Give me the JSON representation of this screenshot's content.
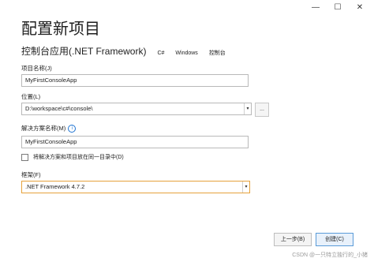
{
  "window": {
    "controls": {
      "minimize": "—",
      "maximize": "☐",
      "close": "✕"
    }
  },
  "header": {
    "title": "配置新项目",
    "template_name": "控制台应用(.NET Framework)",
    "tags": [
      "C#",
      "Windows",
      "控制台"
    ]
  },
  "form": {
    "project_name": {
      "label": "项目名称(J)",
      "value": "MyFirstConsoleApp"
    },
    "location": {
      "label": "位置(L)",
      "value": "D:\\workspace\\c#\\console\\",
      "browse_label": "..."
    },
    "solution_name": {
      "label": "解决方案名称(M)",
      "info": "i",
      "value": "MyFirstConsoleApp"
    },
    "same_dir": {
      "label": "将解决方案和项目放在同一目录中(D)",
      "checked": false
    },
    "framework": {
      "label": "框架(F)",
      "value": ".NET Framework 4.7.2"
    }
  },
  "footer": {
    "back_label": "上一步(B)",
    "create_label": "创建(C)"
  },
  "watermark": "CSDN @一只特立独行的_小猪"
}
